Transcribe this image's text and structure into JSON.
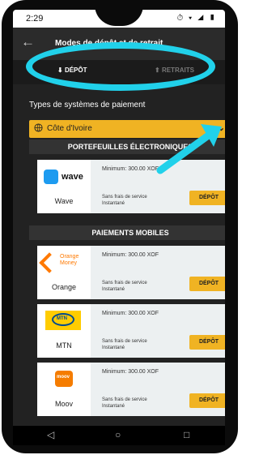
{
  "status": {
    "time": "2:29",
    "icons": "⏱ ▾ ◢ ▮"
  },
  "header": {
    "back": "←",
    "title": "Modes de dépôt et de retrait"
  },
  "tabs": [
    {
      "label": "DÉPÔT"
    },
    {
      "label": "RETRAITS"
    }
  ],
  "payment_type_label": "Types de systèmes de paiement",
  "country": {
    "value": "Côte d'Ivoire"
  },
  "sections": [
    {
      "title": "PORTEFEUILLES ÉLECTRONIQUES",
      "methods": [
        {
          "name": "Wave",
          "minimum": "Minimum: 300.00 XOF",
          "fees": "Sans frais de service",
          "speed": "Instantané",
          "button": "DÉPÔT"
        }
      ]
    },
    {
      "title": "PAIEMENTS MOBILES",
      "methods": [
        {
          "name": "Orange",
          "logo_text": "Orange Money",
          "minimum": "Minimum: 300.00 XOF",
          "fees": "Sans frais de service",
          "speed": "Instantané",
          "button": "DÉPÔT"
        },
        {
          "name": "MTN",
          "minimum": "Minimum: 300.00 XOF",
          "fees": "Sans frais de service",
          "speed": "Instantané",
          "button": "DÉPÔT"
        },
        {
          "name": "Moov",
          "minimum": "Minimum: 300.00 XOF",
          "fees": "Sans frais de service",
          "speed": "Instantané",
          "button": "DÉPÔT"
        }
      ]
    }
  ],
  "colors": {
    "accent": "#f0b323",
    "highlight": "#21d1ea",
    "background": "#222222"
  },
  "navbar": {
    "back": "◁",
    "home": "○",
    "recent": "□"
  }
}
